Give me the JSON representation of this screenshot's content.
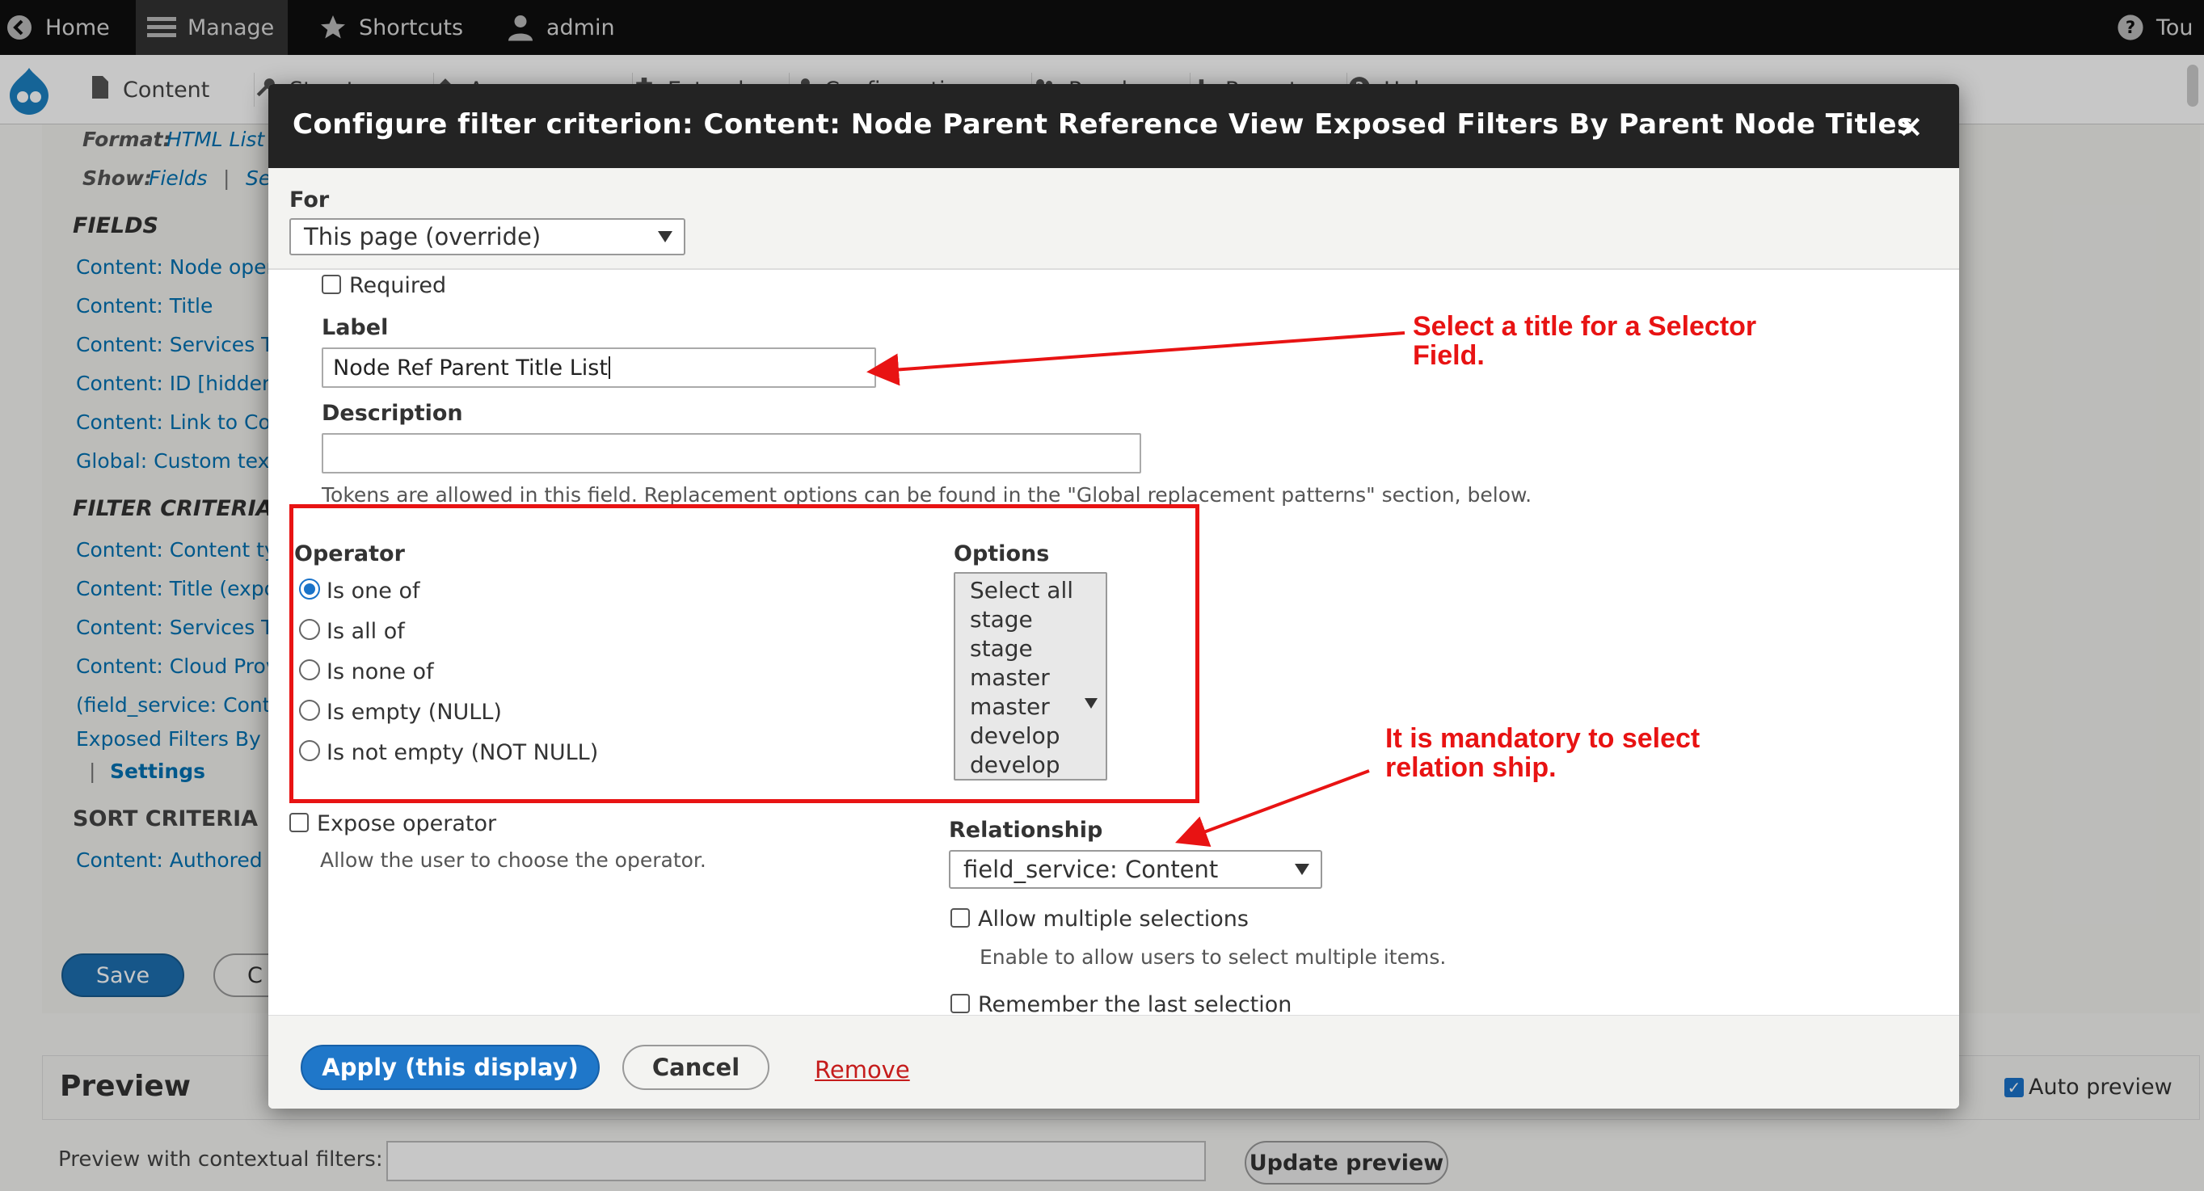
{
  "toolbar": {
    "home": "Home",
    "manage": "Manage",
    "shortcuts": "Shortcuts",
    "user": "admin",
    "tour": "Tou"
  },
  "tray": {
    "content": "Content",
    "structure": "Structure",
    "appearance": "Appearance",
    "extend": "Extend",
    "configuration": "Configuration",
    "people": "People",
    "reports": "Reports",
    "help": "Help"
  },
  "background": {
    "format_label": "Format:",
    "format_value": "HTML List",
    "show_label": "Show:",
    "show_value": "Fields",
    "show_sep": "|",
    "show_more": "Se",
    "fields_heading": "FIELDS",
    "fields": [
      "Content: Node opera",
      "Content: Title",
      "Content: Services Ty",
      "Content: ID [hidden]",
      "Content: Link to Con",
      "Global: Custom text"
    ],
    "filter_heading": "FILTER CRITERIA",
    "filters": [
      "Content: Content typ",
      "Content: Title (expo",
      "Content: Services Ty",
      "Content: Cloud Provi",
      "(field_service: Conte",
      "Exposed Filters By P"
    ],
    "settings_sep": "|",
    "settings": "Settings",
    "sort_heading": "SORT CRITERIA",
    "sorts": [
      "Content: Authored o"
    ],
    "save": "Save",
    "cancel_partial": "C",
    "preview_title": "Preview",
    "auto_preview": "Auto preview",
    "preview_context": "Preview with contextual filters:",
    "update_preview": "Update preview"
  },
  "modal": {
    "title": "Configure filter criterion: Content: Node Parent Reference View Exposed Filters By Parent Node Titles",
    "close": "×",
    "for_label": "For",
    "for_value": "This page (override)",
    "required_label": "Required",
    "label_label": "Label",
    "label_value": "Node Ref Parent Title List",
    "description_label": "Description",
    "description_value": "",
    "tokens_help": "Tokens are allowed in this field. Replacement options can be found in the \"Global replacement patterns\" section, below.",
    "operator_label": "Operator",
    "operators": [
      {
        "label": "Is one of",
        "checked": true
      },
      {
        "label": "Is all of",
        "checked": false
      },
      {
        "label": "Is none of",
        "checked": false
      },
      {
        "label": "Is empty (NULL)",
        "checked": false
      },
      {
        "label": "Is not empty (NOT NULL)",
        "checked": false
      }
    ],
    "options_label": "Options",
    "options": [
      "Select all",
      "stage",
      "stage",
      "master",
      "master",
      "develop",
      "develop"
    ],
    "expose_operator": "Expose operator",
    "expose_help": "Allow the user to choose the operator.",
    "relationship_label": "Relationship",
    "relationship_value": "field_service: Content",
    "allow_multiple": "Allow multiple selections",
    "allow_multiple_help": "Enable to allow users to select multiple items.",
    "remember_last": "Remember the last selection",
    "apply": "Apply (this display)",
    "cancel": "Cancel",
    "remove": "Remove"
  },
  "annotations": {
    "label_note_line1": "Select a title for a Selector",
    "label_note_line2": "Field.",
    "relationship_note_line1": "It is mandatory to select",
    "relationship_note_line2": "relation ship.",
    "color": "#e81313"
  },
  "colors": {
    "toolbar_bg": "#0f0f0f",
    "modal_header_bg": "#232323",
    "primary_button": "#1f77c9",
    "link": "#0071b3",
    "remove_link": "#c51c1c"
  }
}
